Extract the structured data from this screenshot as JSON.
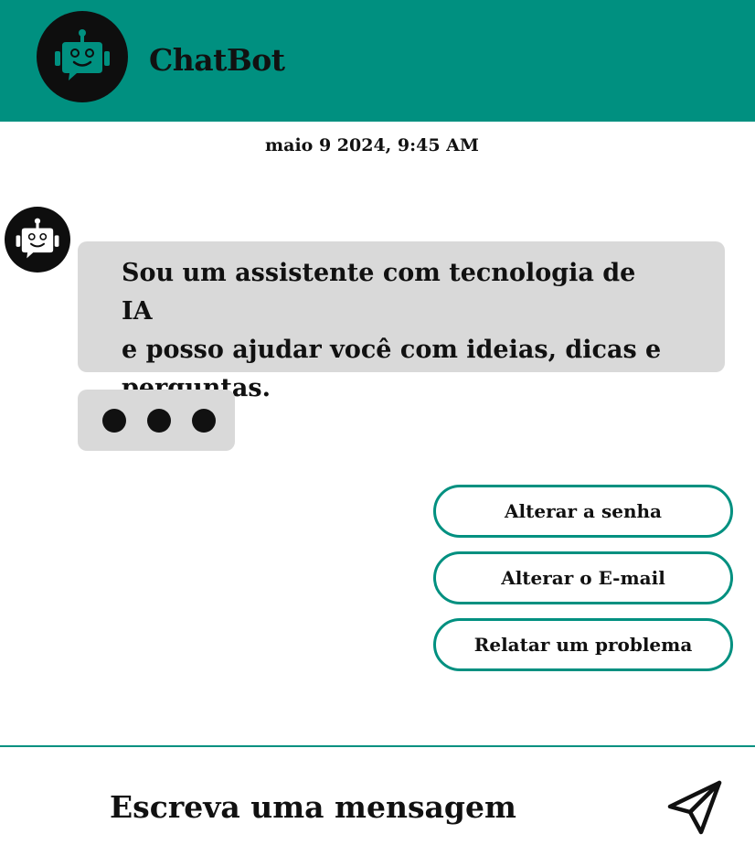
{
  "header": {
    "title": "ChatBot",
    "background_color": "#009080",
    "avatar_icon": "robot-icon"
  },
  "conversation": {
    "timestamp": "maio 9 2024, 9:45 AM",
    "bot_message": {
      "avatar_icon": "robot-icon",
      "text": "Sou um assistente com tecnologia de IA\ne posso ajudar você com ideias, dicas e\nperguntas."
    },
    "typing_indicator": {
      "dots": 3
    },
    "quick_replies": [
      {
        "label": "Alterar a senha"
      },
      {
        "label": "Alterar o E-mail"
      },
      {
        "label": "Relatar um problema"
      }
    ]
  },
  "composer": {
    "placeholder": "Escreva uma mensagem",
    "send_icon": "send-icon"
  },
  "colors": {
    "accent": "#009080",
    "bubble": "#d9d9d9",
    "dark": "#0e0e0e"
  }
}
